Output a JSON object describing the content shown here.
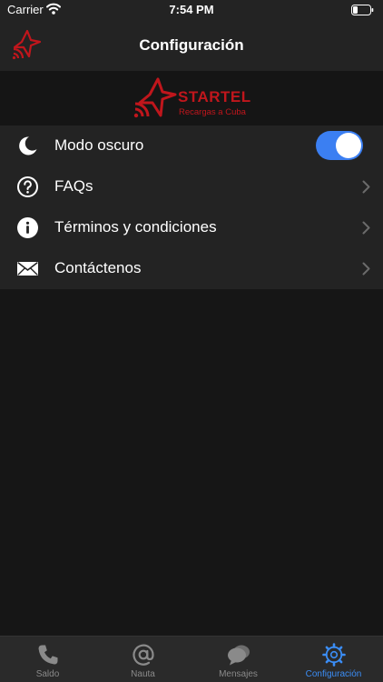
{
  "status_bar": {
    "carrier": "Carrier",
    "time": "7:54 PM"
  },
  "nav": {
    "title": "Configuración"
  },
  "banner": {
    "brand": "STARTEL",
    "tagline": "Recargas a Cuba"
  },
  "settings": {
    "items": [
      {
        "label": "Modo oscuro",
        "icon": "moon-icon",
        "toggle_on": true
      },
      {
        "label": "FAQs",
        "icon": "question-circle-icon"
      },
      {
        "label": "Términos y condiciones",
        "icon": "info-circle-icon"
      },
      {
        "label": "Contáctenos",
        "icon": "envelope-icon"
      }
    ]
  },
  "tabs": [
    {
      "label": "Saldo",
      "icon": "phone-icon",
      "active": false
    },
    {
      "label": "Nauta",
      "icon": "at-sign-icon",
      "active": false
    },
    {
      "label": "Mensajes",
      "icon": "chat-bubbles-icon",
      "active": false
    },
    {
      "label": "Configuración",
      "icon": "gear-icon",
      "active": true
    }
  ],
  "colors": {
    "accent": "#3b7ff2",
    "brand": "#c0161c",
    "background": "#161616",
    "surface": "#232323"
  }
}
